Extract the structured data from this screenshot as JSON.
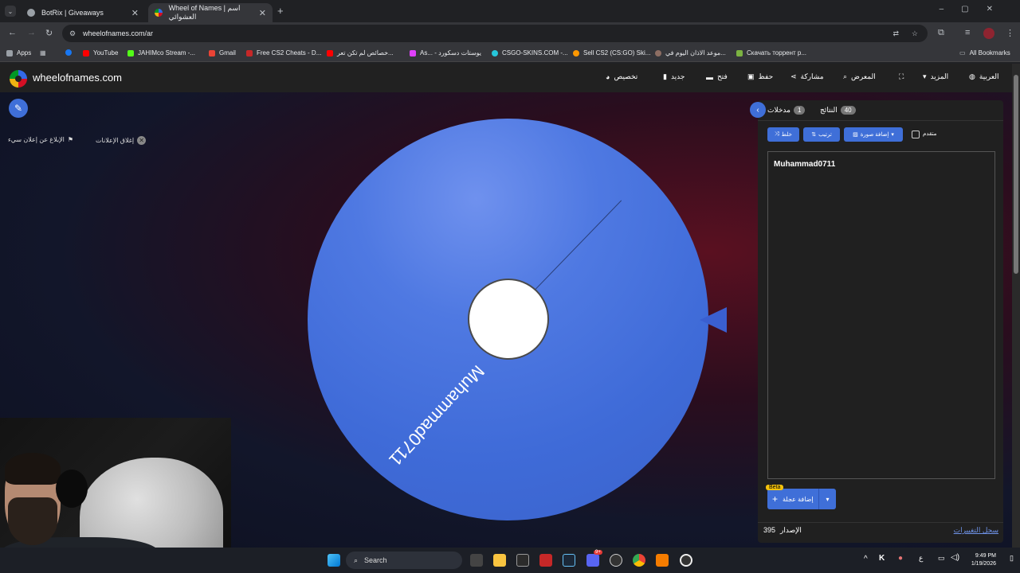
{
  "browser": {
    "tabs": [
      {
        "title": "BotRix | Giveaways",
        "color": "#9aa0a6"
      },
      {
        "title": "Wheel of Names | اسم العشوائي",
        "color": "#3369e8"
      }
    ],
    "url": "wheelofnames.com/ar",
    "bookmarks": [
      {
        "label": "Apps",
        "color": "#9aa0a6"
      },
      {
        "label": "YouTube",
        "color": "#ff0000"
      },
      {
        "label": "JAHIMco Stream -...",
        "color": "#53fc18"
      },
      {
        "label": "Gmail",
        "color": "#ea4335"
      },
      {
        "label": "Free CS2 Cheats - D...",
        "color": "#c62828"
      },
      {
        "label": "خصائص لم تكن تعر...",
        "color": "#ff0000"
      },
      {
        "label": "As... - يوستات دسكورد",
        "color": "#e040fb"
      },
      {
        "label": "CSGO-SKINS.COM -...",
        "color": "#26c6da"
      },
      {
        "label": "Sell CS2 (CS:GO) Ski...",
        "color": "#ff9800"
      },
      {
        "label": "موعد الاذان اليوم في...",
        "color": "#8d6e63"
      },
      {
        "label": "Скачать торрент р...",
        "color": "#7cb342"
      }
    ],
    "all_bookmarks": "All Bookmarks"
  },
  "site": {
    "brand": "wheelofnames.com",
    "menu": {
      "language": "العربية",
      "more": "المزيد",
      "gallery": "المعرض",
      "share": "مشاركة",
      "save": "حفظ",
      "open": "فتح",
      "new": "جديد",
      "customize": "تخصيص"
    },
    "close_ads": "إغلاق الإعلانات",
    "report_ad": "الإبلاغ عن إعلان سيء"
  },
  "wheel": {
    "entries": [
      "Muhammad0711"
    ],
    "slice_color": "#4f79e2",
    "pointer_color": "#3a5fd0"
  },
  "panel": {
    "tab_entries": {
      "label": "مدخلات",
      "count": "1"
    },
    "tab_results": {
      "label": "النتائج",
      "count": "40"
    },
    "shuffle": "خلط",
    "sort": "ترتيب",
    "add_image": "إضافة صورة",
    "advanced": "متقدم",
    "entries_text": "Muhammad0711",
    "add_wheel": "إضافة عجلة",
    "beta": "Beta",
    "version_label": "الإصدار",
    "version_number": "395",
    "changelog": "سجل التغييرات"
  },
  "taskbar": {
    "search": "Search",
    "time": "9:49 PM",
    "date": "1/19/2026",
    "lang": "ع",
    "notification_badge": "9+"
  }
}
